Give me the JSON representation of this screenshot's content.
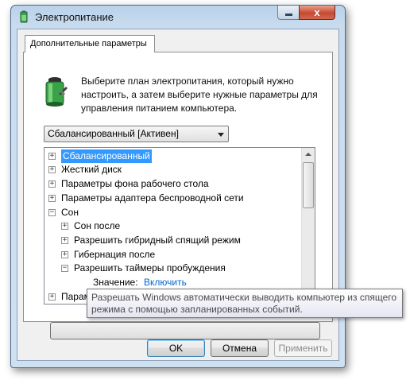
{
  "window": {
    "title": "Электропитание",
    "close_glyph": "x",
    "accent_color": "#3399ff",
    "link_color": "#0066cc"
  },
  "tab": {
    "label": "Дополнительные параметры"
  },
  "intro": {
    "text": "Выберите план электропитания, который нужно настроить, а затем выберите нужные параметры для управления питанием компьютера."
  },
  "plan_select": {
    "value": "Сбалансированный [Активен]"
  },
  "tree": {
    "items": [
      {
        "label": "Сбалансированный",
        "expander": "+",
        "selected": true
      },
      {
        "label": "Жесткий диск",
        "expander": "+"
      },
      {
        "label": "Параметры фона рабочего стола",
        "expander": "+"
      },
      {
        "label": "Параметры адаптера беспроводной сети",
        "expander": "+"
      },
      {
        "label": "Сон",
        "expander": "−"
      },
      {
        "label": "Сон после",
        "expander": "+"
      },
      {
        "label": "Разрешить гибридный спящий режим",
        "expander": "+"
      },
      {
        "label": "Гибернация после",
        "expander": "+"
      },
      {
        "label": "Разрешить таймеры пробуждения",
        "expander": "−"
      },
      {
        "label": "Параметры USB",
        "expander": "+"
      }
    ],
    "value_label": "Значение:",
    "value_link": "Включить"
  },
  "tooltip": {
    "text": "Разрешать Windows автоматически выводить компьютер из спящего режима с помощью запланированных событий."
  },
  "buttons": {
    "ok": "OK",
    "cancel": "Отмена",
    "apply": "Применить"
  }
}
